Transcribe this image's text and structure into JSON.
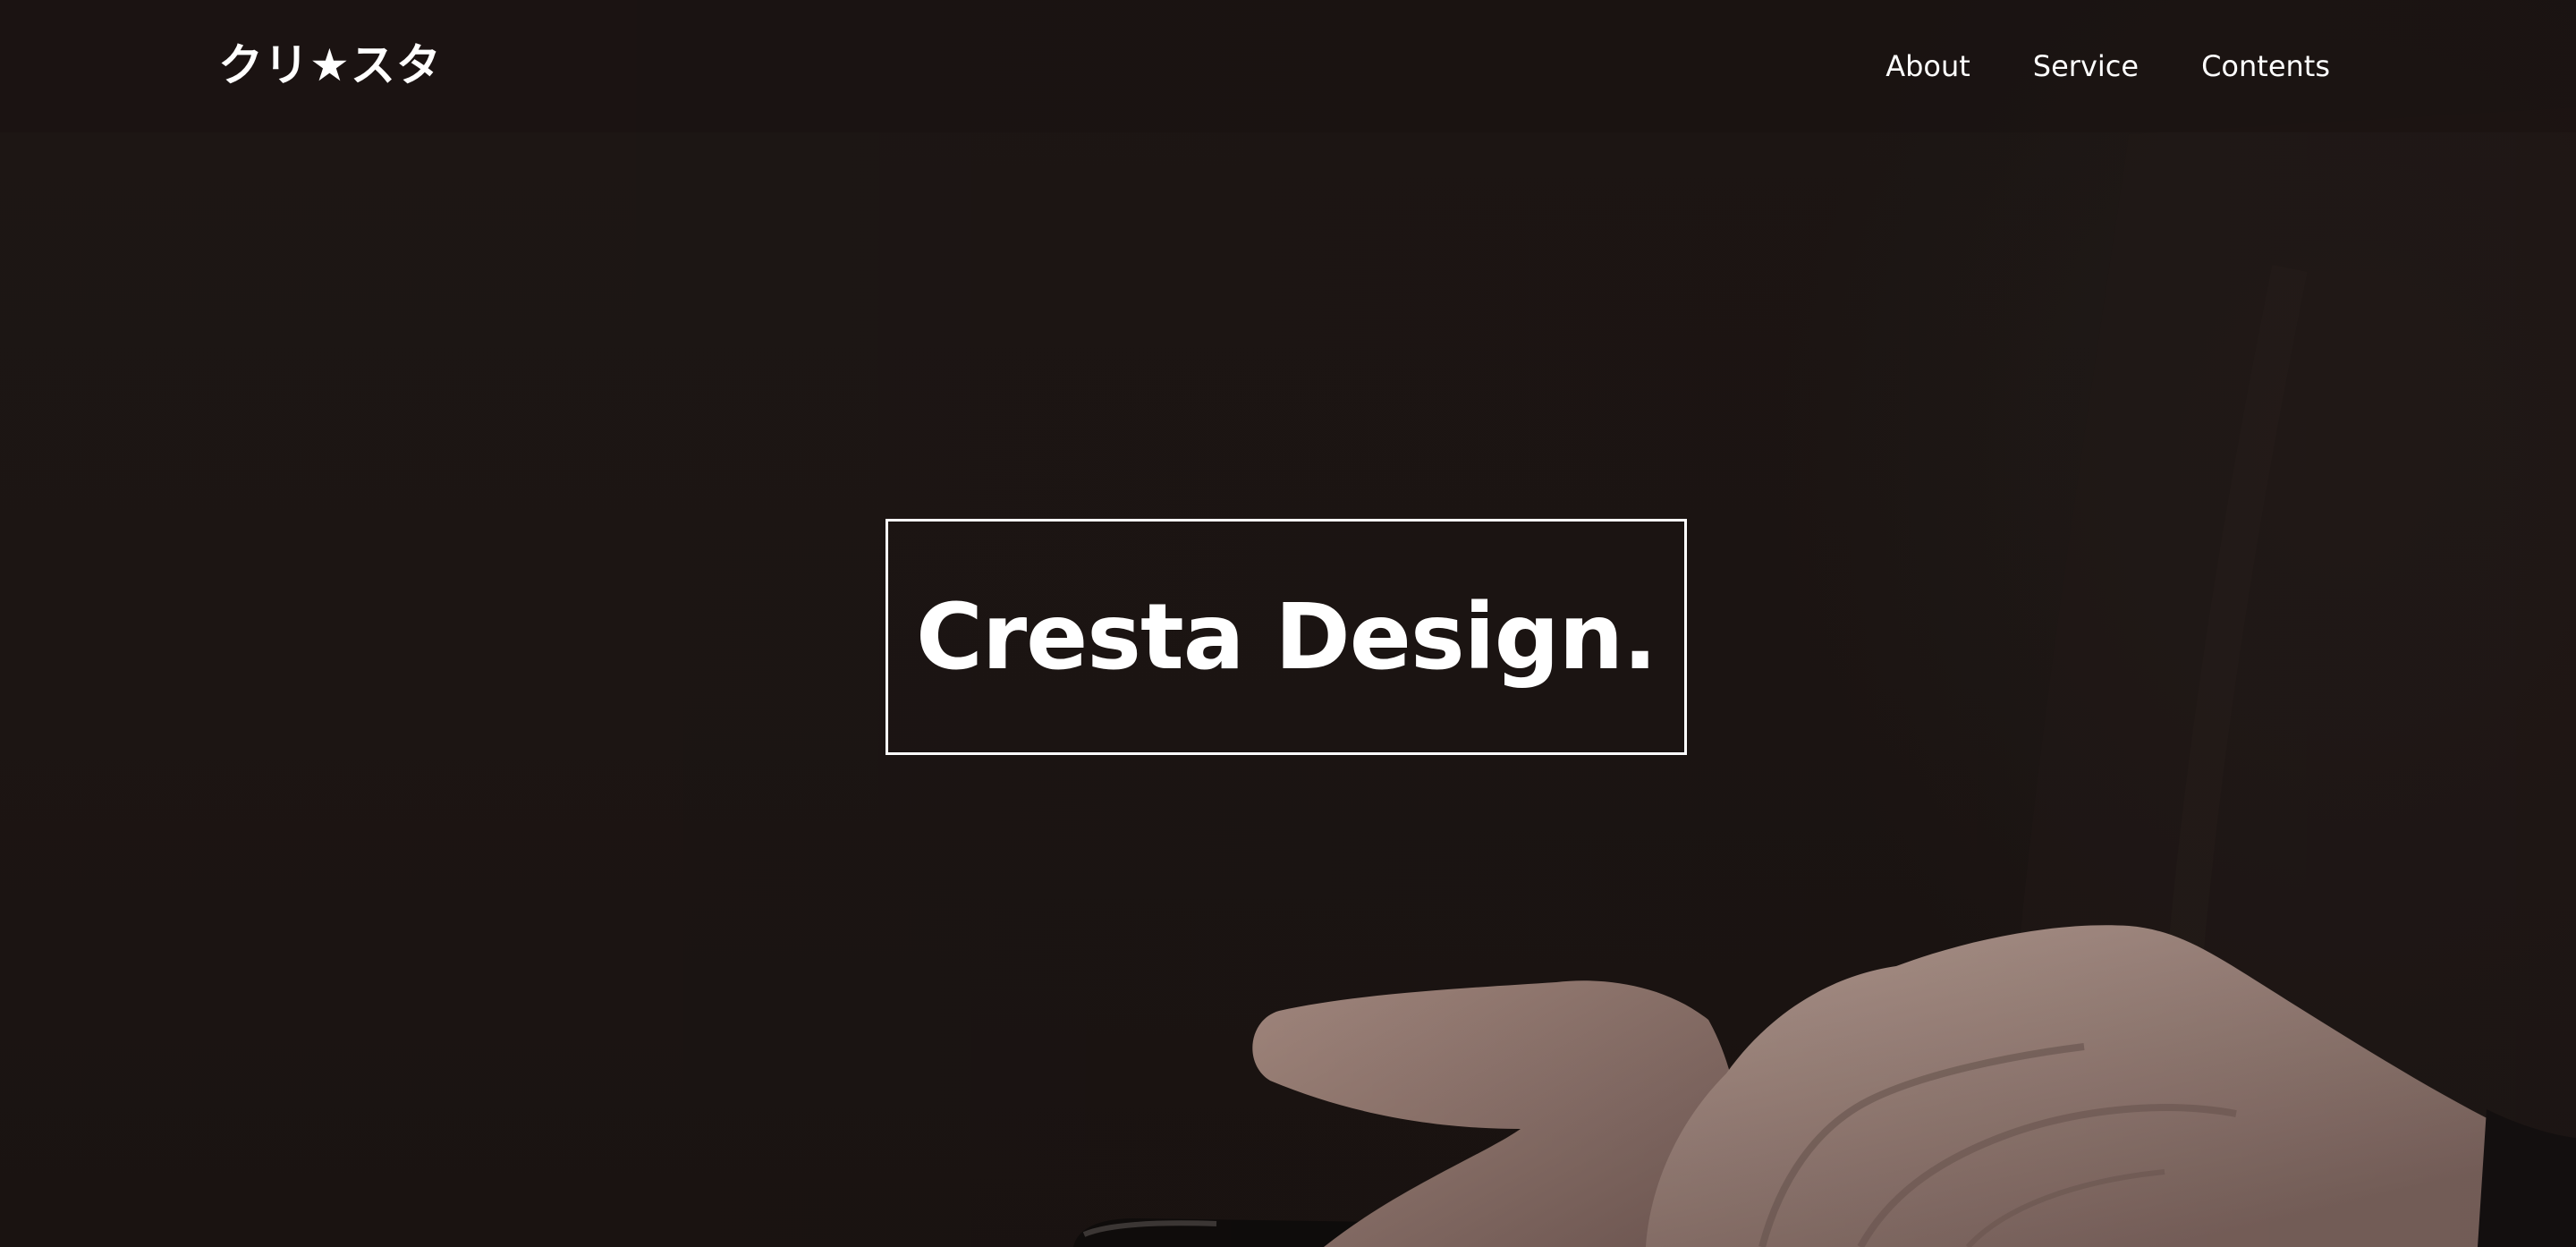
{
  "header": {
    "logo": "クリ★スタ",
    "nav": [
      {
        "label": "About"
      },
      {
        "label": "Service"
      },
      {
        "label": "Contents"
      }
    ]
  },
  "hero": {
    "title": "Cresta Design."
  },
  "colors": {
    "background": "#1b1412",
    "text": "#ffffff",
    "skin": "#9a7f76"
  }
}
